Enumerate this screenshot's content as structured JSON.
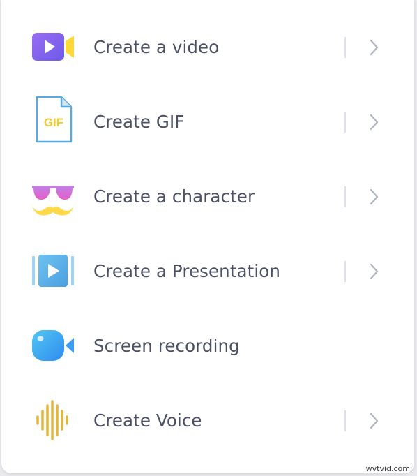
{
  "menu": {
    "items": [
      {
        "label": "Create a video",
        "icon": "video-camera-icon",
        "has_submenu": true
      },
      {
        "label": "Create GIF",
        "icon": "gif-file-icon",
        "has_submenu": true
      },
      {
        "label": "Create a character",
        "icon": "sunglasses-mustache-icon",
        "has_submenu": true
      },
      {
        "label": "Create a Presentation",
        "icon": "presentation-play-icon",
        "has_submenu": true
      },
      {
        "label": "Screen recording",
        "icon": "screen-record-camera-icon",
        "has_submenu": false
      },
      {
        "label": "Create Voice",
        "icon": "voice-waveform-icon",
        "has_submenu": true
      }
    ]
  },
  "icons": {
    "gif_text": "GIF"
  },
  "colors": {
    "label_text": "#4b5064",
    "divider": "#dfe1e8",
    "chevron": "#aeb3c0",
    "video_purple": "#7b61f0",
    "video_yellow": "#ffd83a",
    "gif_blue": "#5aa9de",
    "gif_yellow": "#f3c92b",
    "character_pink": "#d86ad8",
    "mustache_yellow": "#ffd94a",
    "presentation_blue": "#5fb6e8",
    "record_blue": "#3fa8f5",
    "voice_gold": "#e2b53f"
  },
  "watermark": "wvtvid.com"
}
